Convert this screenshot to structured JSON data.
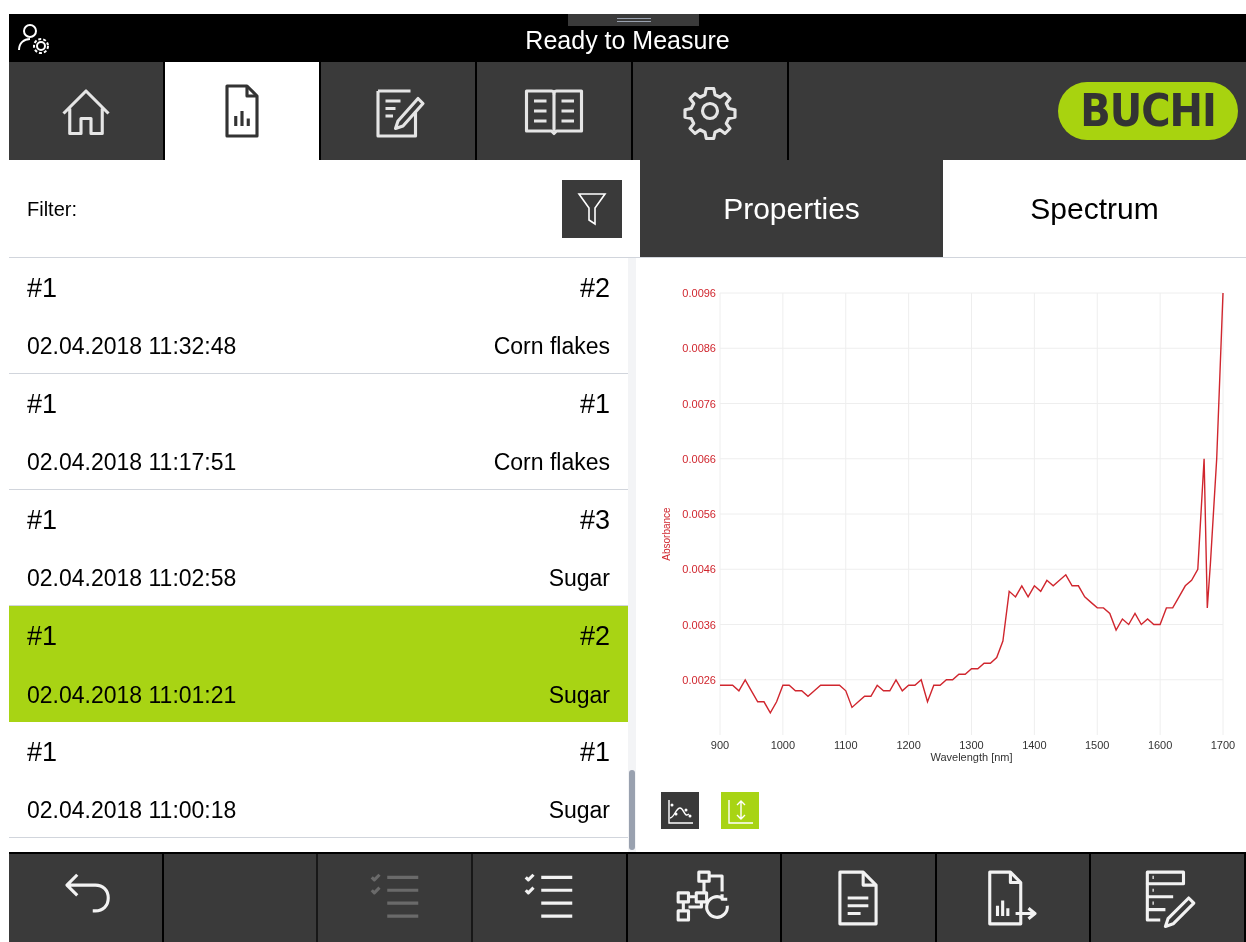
{
  "status_bar": {
    "title": "Ready to Measure"
  },
  "nav_tabs": [
    {
      "kind": "home",
      "selected": false
    },
    {
      "kind": "report",
      "selected": true
    },
    {
      "kind": "edit",
      "selected": false
    },
    {
      "kind": "book",
      "selected": false
    },
    {
      "kind": "settings",
      "selected": false
    }
  ],
  "logo": {
    "text": "BUCHI"
  },
  "filter": {
    "label": "Filter:"
  },
  "results": [
    {
      "number": "#1",
      "index": "#2",
      "timestamp": "02.04.2018 11:32:48",
      "product": "Corn flakes",
      "selected": false
    },
    {
      "number": "#1",
      "index": "#1",
      "timestamp": "02.04.2018 11:17:51",
      "product": "Corn flakes",
      "selected": false
    },
    {
      "number": "#1",
      "index": "#3",
      "timestamp": "02.04.2018 11:02:58",
      "product": "Sugar",
      "selected": false
    },
    {
      "number": "#1",
      "index": "#2",
      "timestamp": "02.04.2018 11:01:21",
      "product": "Sugar",
      "selected": true
    },
    {
      "number": "#1",
      "index": "#1",
      "timestamp": "02.04.2018 11:00:18",
      "product": "Sugar",
      "selected": false
    }
  ],
  "detail_tabs": [
    {
      "label": "Properties",
      "selected": false
    },
    {
      "label": "Spectrum",
      "selected": true
    }
  ],
  "chart_data": {
    "type": "line",
    "grid": true,
    "xlabel": "Wavelength [nm]",
    "ylabel": "Absorbance",
    "x": [
      900,
      910,
      920,
      930,
      940,
      950,
      960,
      970,
      980,
      990,
      1000,
      1010,
      1020,
      1030,
      1040,
      1050,
      1060,
      1070,
      1080,
      1090,
      1100,
      1110,
      1120,
      1130,
      1140,
      1150,
      1160,
      1170,
      1180,
      1190,
      1200,
      1210,
      1220,
      1230,
      1240,
      1250,
      1260,
      1270,
      1280,
      1290,
      1300,
      1310,
      1320,
      1330,
      1340,
      1350,
      1360,
      1370,
      1380,
      1390,
      1400,
      1410,
      1420,
      1430,
      1440,
      1450,
      1460,
      1470,
      1480,
      1490,
      1500,
      1510,
      1520,
      1530,
      1540,
      1550,
      1560,
      1570,
      1580,
      1590,
      1600,
      1610,
      1620,
      1630,
      1640,
      1650,
      1660,
      1670,
      1675,
      1680,
      1690,
      1700
    ],
    "series": [
      {
        "color": "#d0262e",
        "values": [
          0.0025,
          0.0025,
          0.0025,
          0.0024,
          0.0026,
          0.0024,
          0.0022,
          0.0022,
          0.002,
          0.0022,
          0.0025,
          0.0025,
          0.0024,
          0.0024,
          0.0023,
          0.0024,
          0.0025,
          0.0025,
          0.0025,
          0.0025,
          0.0024,
          0.0021,
          0.0022,
          0.0023,
          0.0023,
          0.0025,
          0.0024,
          0.0024,
          0.0026,
          0.0024,
          0.0025,
          0.0025,
          0.0026,
          0.0022,
          0.0025,
          0.0025,
          0.0026,
          0.0026,
          0.0027,
          0.0027,
          0.0028,
          0.0028,
          0.0029,
          0.0029,
          0.003,
          0.0033,
          0.0042,
          0.0041,
          0.0043,
          0.0041,
          0.0043,
          0.0042,
          0.0044,
          0.0043,
          0.0044,
          0.0045,
          0.0043,
          0.0043,
          0.0041,
          0.004,
          0.0039,
          0.0039,
          0.0038,
          0.0035,
          0.0037,
          0.0036,
          0.0038,
          0.0036,
          0.0037,
          0.0036,
          0.0036,
          0.0039,
          0.0039,
          0.0041,
          0.0043,
          0.0044,
          0.0046,
          0.0066,
          0.0039,
          0.0047,
          0.0066,
          0.0096
        ]
      }
    ],
    "xlim": [
      900,
      1700
    ],
    "ylim": [
      0.0016,
      0.0096
    ],
    "xticks": [
      900,
      1000,
      1100,
      1200,
      1300,
      1400,
      1500,
      1600,
      1700
    ],
    "yticks": [
      {
        "value": 0.0026,
        "label": "0.0026"
      },
      {
        "value": 0.0036,
        "label": "0.0036"
      },
      {
        "value": 0.0046,
        "label": "0.0046"
      },
      {
        "value": 0.0056,
        "label": "0.0056"
      },
      {
        "value": 0.0066,
        "label": "0.0066"
      },
      {
        "value": 0.0076,
        "label": "0.0076"
      },
      {
        "value": 0.0086,
        "label": "0.0086"
      },
      {
        "value": 0.0096,
        "label": "0.0096"
      }
    ]
  },
  "chart_tools": [
    {
      "kind": "fit",
      "selected": false
    },
    {
      "kind": "scale",
      "selected": true
    }
  ],
  "bottom_buttons": [
    {
      "kind": "back",
      "disabled": false
    },
    {
      "kind": "blank",
      "disabled": true
    },
    {
      "kind": "checklist",
      "disabled": true
    },
    {
      "kind": "checklist",
      "disabled": false
    },
    {
      "kind": "workflow",
      "disabled": false
    },
    {
      "kind": "document",
      "disabled": false
    },
    {
      "kind": "export",
      "disabled": false
    },
    {
      "kind": "edit-list",
      "disabled": false
    }
  ]
}
